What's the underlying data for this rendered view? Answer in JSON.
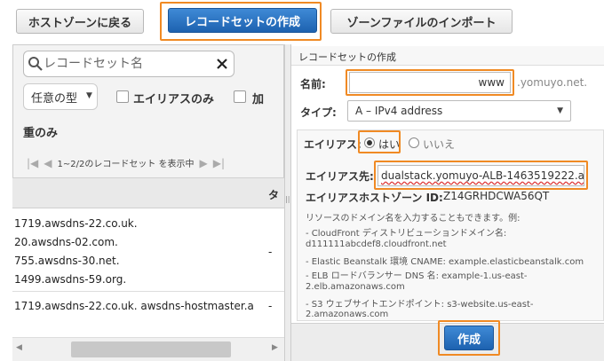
{
  "toolbar": {
    "back_label": "ホストゾーンに戻る",
    "create_label": "レコードセットの作成",
    "import_label": "ゾーンファイルのインポート"
  },
  "left": {
    "search_placeholder": "レコードセット名",
    "type_select": "任意の型",
    "alias_only_label": "エイリアスのみ",
    "weighted_label_part1": "加",
    "weighted_label_part2": "重のみ",
    "pager_text": "1~2/2のレコードセット を表示中",
    "col_header": "タ",
    "rows": [
      {
        "lines": [
          "1719.awsdns-22.co.uk.",
          "20.awsdns-02.com.",
          "755.awsdns-30.net.",
          "1499.awsdns-59.org."
        ],
        "type": "-"
      },
      {
        "lines": [
          "1719.awsdns-22.co.uk. awsdns-hostmaster.amaz"
        ],
        "type": "-"
      }
    ]
  },
  "right": {
    "header": "レコードセットの作成",
    "name_label": "名前:",
    "name_value": "www",
    "domain_suffix": ".yomuyo.net.",
    "type_label": "タイプ:",
    "type_value": "A – IPv4 address",
    "alias_label": "エイリアス:",
    "alias_yes": "はい",
    "alias_no": "いいえ",
    "alias_target_label": "エイリアス先:",
    "alias_target_value": "dualstack.yomuyo-ALB-1463519222.a",
    "alias_zone_label": "エイリアスホストゾーン ID:",
    "alias_zone_value": "Z14GRHDCWA56QT",
    "help_lines": [
      "リソースのドメイン名を入力することもできます。例:",
      "- CloudFront ディストリビューションドメイン名:",
      "d111111abcdef8.cloudfront.net",
      "- Elastic Beanstalk 環境 CNAME: example.elasticbeanstalk.com",
      "- ELB ロードバランサー DNS 名: example-1.us-east-",
      "2.elb.amazonaws.com",
      "- S3 ウェブサイトエンドポイント: s3-website.us-east-",
      "2.amazonaws.com"
    ],
    "submit_label": "作成"
  },
  "colors": {
    "highlight": "#f08a24",
    "primary": "#1d62b0"
  }
}
